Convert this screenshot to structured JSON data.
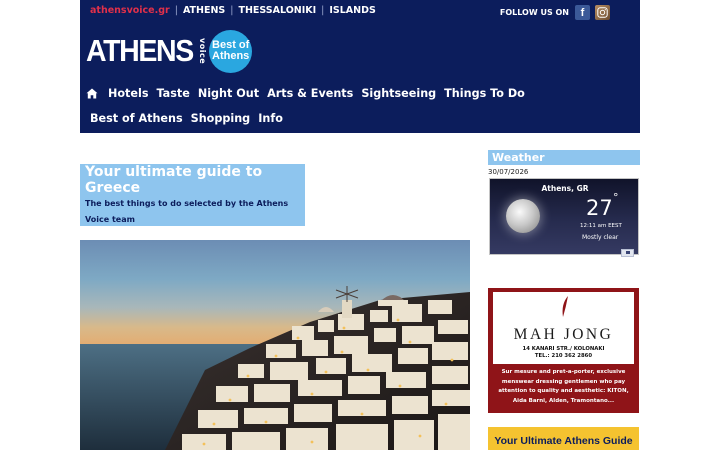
{
  "top_bar": {
    "site": "athensvoice.gr",
    "sep": "|",
    "links": [
      "ATHENS",
      "THESSALONIKI",
      "ISLANDS"
    ],
    "follow_label": "FOLLOW US ON",
    "facebook_glyph": "f",
    "social_icons": [
      "facebook-icon",
      "instagram-icon"
    ]
  },
  "logo": {
    "wordmark": "ATHENS",
    "vertical": "voice",
    "badge_line1": "Best of",
    "badge_line2": "Athens"
  },
  "nav": {
    "home_icon": "home-icon",
    "items": [
      "Hotels",
      "Taste",
      "Night Out",
      "Arts & Events",
      "Sightseeing",
      "Things To Do",
      "Best of Athens",
      "Shopping",
      "Info"
    ]
  },
  "intro": {
    "title": "Your ultimate guide to Greece",
    "subtitle": "The best things to do selected by the Athens Voice team"
  },
  "weather": {
    "heading": "Weather",
    "date": "30/07/2026",
    "location": "Athens, GR",
    "temperature": "27",
    "degree": "°",
    "time": "12:11 am EEST",
    "condition": "Mostly clear",
    "icon": "moon-icon"
  },
  "ad": {
    "name": "MAH JONG",
    "address": "14 KANARI STR./ KOLONAKI",
    "tel": "TEL.: 210 362 2860",
    "text": "Sur mesure and pret-a-porter, exclusive menswear dressing gentlemen who pay attention to quality and aesthetic: KITON, Aida Barni, Alden, Tramontano..."
  },
  "guide_banner": "Your Ultimate Athens Guide",
  "colors": {
    "header_navy": "#0c1d5c",
    "accent_red": "#e0304a",
    "light_blue": "#8ec5ee",
    "badge_blue": "#2aa7e0",
    "ad_red": "#8f1418",
    "banner_yellow": "#f5c330"
  }
}
